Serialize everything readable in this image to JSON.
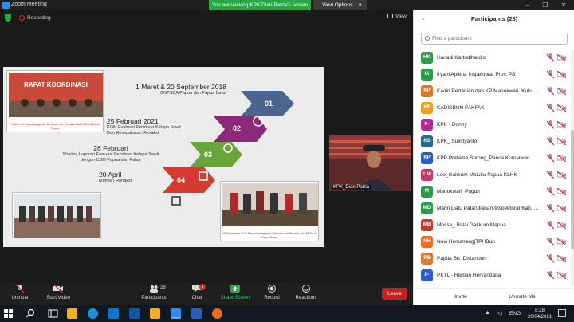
{
  "window": {
    "title": "Zoom Meeting",
    "viewing_banner": "You are viewing KPK Dian Patria's screen",
    "view_options": "View Options"
  },
  "meeting": {
    "recording_label": "Recording",
    "view_label": "View",
    "video_tile_name": "KPK_Dian Patria"
  },
  "slide": {
    "photo_top_left": {
      "title_lines": [
        "RAPAT KOORDINASI"
      ],
      "caption": "1 Maret & Penandatanganan Deklarasi dan Renaksi Aksi PDSA di Sawit Papua"
    },
    "photo_bottom_right": {
      "caption": "20 September 2018 Penandatanganan Deklarasi dan Renaksi Aksi PDSA di Papua Barat"
    },
    "steps": [
      {
        "num": "01",
        "date": "1 Maret & 20 September 2018",
        "desc": [
          "GNPSDA Papua dan Papua Barat"
        ],
        "color": "#4b6590"
      },
      {
        "num": "02",
        "date": "25 Februari 2021",
        "desc": [
          "KOM Evaluasi Perizinan Kelapa Sawit",
          "Dan Kesepakatan Renaksi"
        ],
        "color": "#8b2a7a"
      },
      {
        "num": "03",
        "date": "26 Februari",
        "desc": [
          "Sharing Laporan Evaluasi Perizinan Kelapa Sawit",
          "dengan CSO Papua dan Pabar"
        ],
        "color": "#6aa53a"
      },
      {
        "num": "04",
        "date": "20 April",
        "desc": [
          "Monev I Renaksi"
        ],
        "color": "#d43a2f"
      }
    ]
  },
  "toolbar": {
    "unmute": "Unmute",
    "start_video": "Start Video",
    "participants": "Participants",
    "participants_count": "28",
    "chat": "Chat",
    "chat_badge": "1",
    "share_screen": "Share Screen",
    "record": "Record",
    "reactions": "Reactions",
    "leave": "Leave"
  },
  "panel": {
    "title": "Participants (28)",
    "search_placeholder": "Find a participant",
    "participants": [
      {
        "initials": "HK",
        "name": "Hariadi Kartodihardjo",
        "color": "#2e9a4a"
      },
      {
        "initials": "IA",
        "name": "Iryani Aplena Inspektorat Prov. PB",
        "color": "#2e9a4a"
      },
      {
        "initials": "KP",
        "name": "Kadin Pertanian dan KP Manokwari. Kukuh ...",
        "color": "#e0762a"
      },
      {
        "initials": "KF",
        "name": "KADISBUN FAKFAK",
        "color": "#f0a020"
      },
      {
        "initials": "K-",
        "name": "KPK - Donny",
        "color": "#b02a9a"
      },
      {
        "initials": "KS",
        "name": "KPK_ Sulistyanto",
        "color": "#2a6a8a"
      },
      {
        "initials": "KP",
        "name": "KPP Pratama Sorong_Panca Kurniawan",
        "color": "#2a5ad4"
      },
      {
        "initials": "LM",
        "name": "Leo_Gakkum Maluku Papua KLHK",
        "color": "#c8386a"
      },
      {
        "initials": "M",
        "name": "Manokwari_Puguh",
        "color": "#2e9a4a"
      },
      {
        "initials": "MD",
        "name": "Marin Datu Patandianan-Inspektorat Kab. S...",
        "color": "#2e9a4a"
      },
      {
        "initials": "MB",
        "name": "Mossa_ Balai Gakkum Mapua",
        "color": "#c83a2a"
      },
      {
        "initials": "NH",
        "name": "Novi Hemanang|TPHBun",
        "color": "#f06a2a"
      },
      {
        "initials": "PB",
        "name": "Papua Brt_Distanbun",
        "color": "#e0762a"
      },
      {
        "initials": "P-",
        "name": "PKTL - Herban Heryandana",
        "color": "#2a5ad4"
      }
    ],
    "invite": "Invite",
    "unmute_me": "Unmute Me"
  },
  "taskbar": {
    "language": "ENG",
    "time": "8:28",
    "date": "20/04/2021"
  },
  "colors": {
    "zoom_blue": "#2d8cff",
    "banner_green": "#27a844",
    "leave_red": "#c81f1f",
    "muted_red": "#e02828"
  }
}
